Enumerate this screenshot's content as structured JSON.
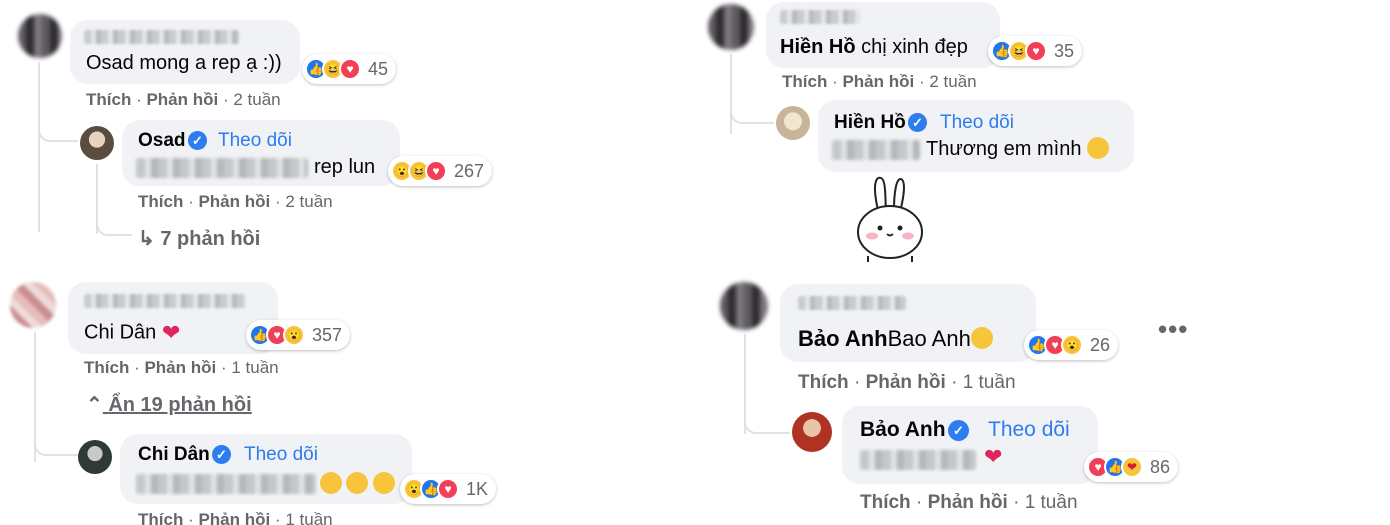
{
  "panel1": {
    "comment": {
      "name": "",
      "text": "Osad mong a rep ạ :))",
      "reaction_count": "45",
      "like": "Thích",
      "reply": "Phản hồi",
      "time": "2 tuần"
    },
    "reply": {
      "name": "Osad",
      "follow": "Theo dõi",
      "text": "rep lun",
      "reaction_count": "267",
      "like": "Thích",
      "reply": "Phản hồi",
      "time": "2 tuần"
    },
    "more_replies": "7 phản hồi"
  },
  "panel2": {
    "comment": {
      "text": "chị xinh đẹp",
      "tag": "Hiền Hồ",
      "reaction_count": "35",
      "like": "Thích",
      "reply": "Phản hồi",
      "time": "2 tuần"
    },
    "reply": {
      "name": "Hiền Hồ",
      "follow": "Theo dõi",
      "text": "Thương em mình"
    }
  },
  "panel3": {
    "comment": {
      "text": "Chi Dân",
      "reaction_count": "357",
      "like": "Thích",
      "reply": "Phản hồi",
      "time": "1 tuần"
    },
    "hide_replies": "Ẩn 19 phản hồi",
    "reply": {
      "name": "Chi Dân",
      "follow": "Theo dõi",
      "reaction_count": "1K",
      "like": "Thích",
      "reply": "Phản hồi",
      "time": "1 tuần"
    }
  },
  "panel4": {
    "comment": {
      "tag": "Bảo Anh",
      "text": "Bao Anh",
      "reaction_count": "26",
      "like": "Thích",
      "reply": "Phản hồi",
      "time": "1 tuần",
      "more": "•••"
    },
    "reply": {
      "name": "Bảo Anh",
      "follow": "Theo dõi",
      "reaction_count": "86",
      "like": "Thích",
      "reply": "Phản hồi",
      "time": "1 tuần"
    }
  },
  "colors": {
    "link": "#2d7cf0",
    "bubble": "#f0f2f5",
    "meta": "#65676b",
    "like": "#1d76f2",
    "love": "#f33e58"
  },
  "icons": [
    "like-reaction-icon",
    "love-reaction-icon",
    "haha-reaction-icon",
    "wow-reaction-icon",
    "care-reaction-icon",
    "verified-badge-icon",
    "reply-arrow-icon",
    "chevron-up-icon",
    "more-options-icon"
  ]
}
